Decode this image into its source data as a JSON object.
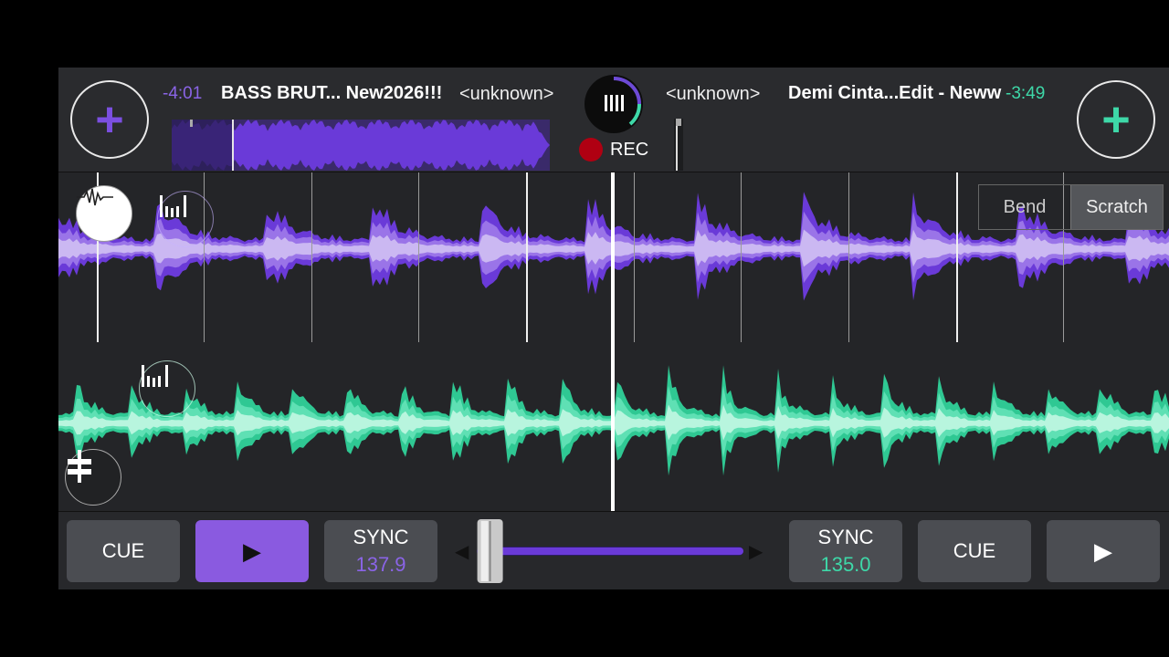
{
  "deck_left": {
    "time": "-4:01",
    "title": "BASS BRUT... New2026!!!",
    "artist": "<unknown>",
    "accent": "#7b4fe0",
    "add_icon": "+",
    "cue_label": "CUE",
    "play_icon": "▶",
    "sync_label": "SYNC",
    "bpm": "137.9"
  },
  "deck_right": {
    "time": "-3:49",
    "title": "Demi Cinta...Edit - Neww",
    "artist": "<unknown>",
    "accent": "#3ed8a8",
    "add_icon": "+",
    "cue_label": "CUE",
    "play_icon": "▶",
    "sync_label": "SYNC",
    "bpm": "135.0"
  },
  "recorder": {
    "label": "REC",
    "color": "#b00012"
  },
  "modes": {
    "bend": "Bend",
    "scratch": "Scratch",
    "active": "Scratch"
  },
  "icons": {
    "waveform": "waveform-icon",
    "left_pad": "equalizer-bars-icon",
    "right_pad": "equalizer-bars-icon",
    "fx": "split-fader-icon",
    "logo": "turntable-logo-icon"
  },
  "crossfader": {
    "position": 0.05,
    "left_arrow": "◀",
    "right_arrow": "▶"
  }
}
